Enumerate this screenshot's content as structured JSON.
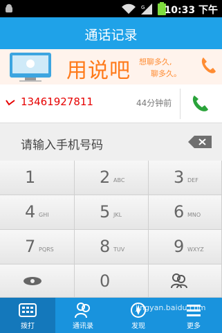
{
  "status_bar": {
    "time": "10:33 下午"
  },
  "title_bar": {
    "title": "通话记录"
  },
  "banner": {
    "brand": "用说吧",
    "tagline_1": "想聊多久,",
    "tagline_2": "聊多久。"
  },
  "call_log": [
    {
      "number": "13461927811",
      "time_ago": "44分钟前"
    }
  ],
  "dial_input": {
    "placeholder": "请输入手机号码"
  },
  "keypad": {
    "keys": [
      {
        "digit": "1",
        "letters": ""
      },
      {
        "digit": "2",
        "letters": "ABC"
      },
      {
        "digit": "3",
        "letters": "DEF"
      },
      {
        "digit": "4",
        "letters": "GHI"
      },
      {
        "digit": "5",
        "letters": "JKL"
      },
      {
        "digit": "6",
        "letters": "MNO"
      },
      {
        "digit": "7",
        "letters": "PQRS"
      },
      {
        "digit": "8",
        "letters": "TUV"
      },
      {
        "digit": "9",
        "letters": "WXYZ"
      },
      {
        "digit": "",
        "letters": ""
      },
      {
        "digit": "0",
        "letters": ""
      },
      {
        "digit": "",
        "letters": ""
      }
    ]
  },
  "bottom_nav": {
    "items": [
      {
        "label": "拨打",
        "icon": "dialpad-icon"
      },
      {
        "label": "通讯录",
        "icon": "contacts-icon"
      },
      {
        "label": "发现",
        "icon": "discover-icon"
      },
      {
        "label": "更多",
        "icon": "more-icon"
      }
    ]
  },
  "watermark": {
    "text": "jingyan.baidu.com"
  },
  "colors": {
    "title_bar": "#1fa2e8",
    "bottom_nav": "#1993dd",
    "accent_orange": "#ff7a1a",
    "call_green": "#2aa33a"
  }
}
